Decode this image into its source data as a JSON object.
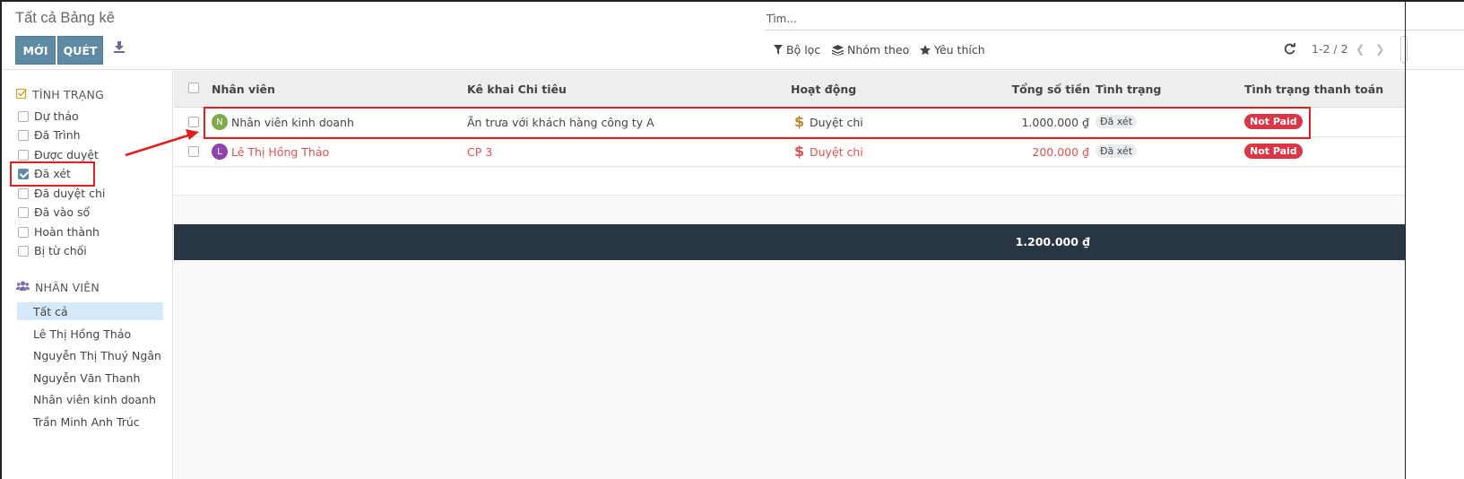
{
  "header": {
    "title": "Tất cả Bảng kê",
    "new_label": "MỚI",
    "scan_label": "QUÉT",
    "search_placeholder": "Tìm...",
    "filter_label": "Bộ lọc",
    "group_label": "Nhóm theo",
    "favorite_label": "Yêu thích",
    "pager": "1-2 / 2"
  },
  "sidebar": {
    "status_heading": "TÌNH TRẠNG",
    "statuses": [
      {
        "label": "Dự thảo",
        "checked": false
      },
      {
        "label": "Đã Trình",
        "checked": false
      },
      {
        "label": "Được duyệt",
        "checked": false
      },
      {
        "label": "Đã xét",
        "checked": true
      },
      {
        "label": "Đã duyệt chi",
        "checked": false
      },
      {
        "label": "Đã vào sổ",
        "checked": false
      },
      {
        "label": "Hoàn thành",
        "checked": false
      },
      {
        "label": "Bị từ chối",
        "checked": false
      }
    ],
    "employee_heading": "NHÂN VIÊN",
    "employees": [
      "Tất cả",
      "Lê Thị Hồng Thảo",
      "Nguyễn Thị Thuý Ngân",
      "Nguyễn Văn Thanh",
      "Nhân viên kinh doanh",
      "Trần Minh Anh Trúc"
    ]
  },
  "table": {
    "columns": [
      "Nhân viên",
      "Kê khai Chi tiêu",
      "Hoạt động",
      "Tổng số tiền",
      "Tình trạng",
      "Tình trạng thanh toán"
    ],
    "rows": [
      {
        "avatar": "N",
        "employee": "Nhân viên kinh doanh",
        "expense": "Ăn trưa với khách hàng công ty A",
        "activity": "Duyệt chi",
        "amount": "1.000.000 ₫",
        "status": "Đã xét",
        "payment": "Not Paid"
      },
      {
        "avatar": "L",
        "employee": "Lê Thị Hồng Thảo",
        "expense": "CP 3",
        "activity": "Duyệt chi",
        "amount": "200.000 ₫",
        "status": "Đã xét",
        "payment": "Not Paid"
      }
    ],
    "total": "1.200.000 ₫"
  },
  "colors": {
    "primary": "#5f8aa3",
    "danger": "#dc3545",
    "overdue_text": "#d9534f",
    "footer": "#273642",
    "annotation": "#e02020"
  }
}
